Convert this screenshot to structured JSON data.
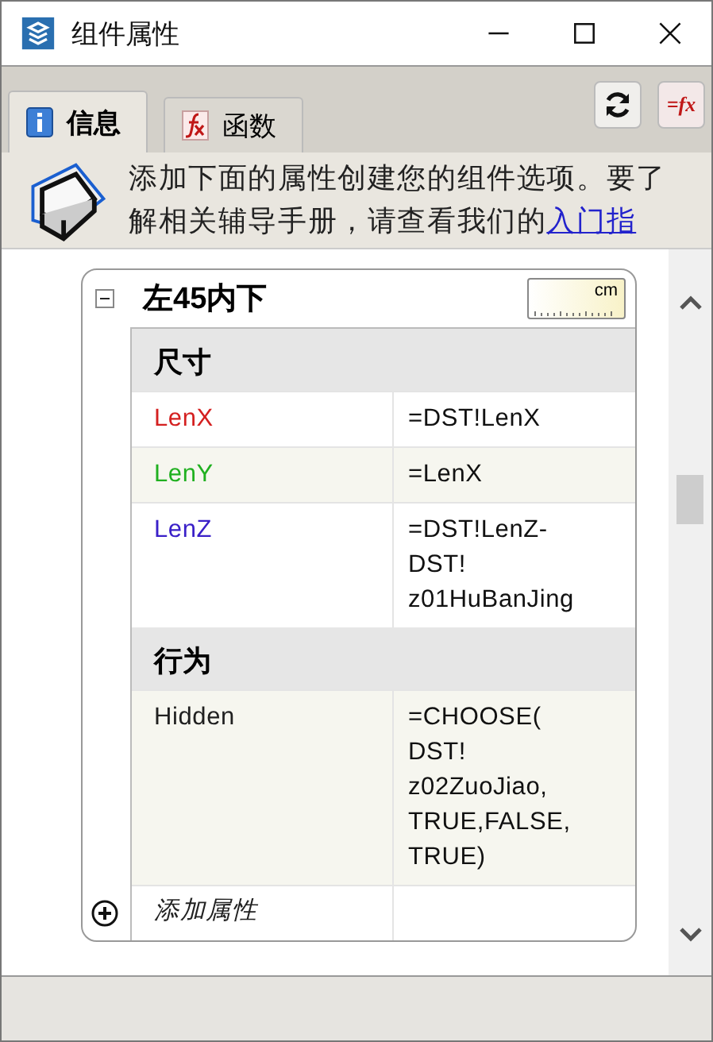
{
  "window": {
    "title": "组件属性"
  },
  "tabs": [
    {
      "label": "信息",
      "selected": true
    },
    {
      "label": "函数",
      "selected": false
    }
  ],
  "toolbar": {
    "formula_button": "=fx"
  },
  "info": {
    "text": "添加下面的属性创建您的组件选项。要了解相关辅导手册，请查看我们的",
    "link": "入门指"
  },
  "component": {
    "title": "左45内下",
    "expanded": true,
    "unit": "cm",
    "groups": [
      {
        "title": "尺寸",
        "rows": [
          {
            "name": "LenX",
            "color": "#d42020",
            "value": [
              "=DST!LenX"
            ]
          },
          {
            "name": "LenY",
            "color": "#20b020",
            "value": [
              "=LenX"
            ]
          },
          {
            "name": "LenZ",
            "color": "#3a20c8",
            "value": [
              "=DST!LenZ-",
              "DST!",
              "z01HuBanJing"
            ]
          }
        ]
      },
      {
        "title": "行为",
        "rows": [
          {
            "name": "Hidden",
            "color": "#202020",
            "value": [
              "=CHOOSE(",
              "DST!",
              "z02ZuoJiao,",
              "TRUE,FALSE,",
              "TRUE)"
            ]
          }
        ]
      }
    ],
    "add_label": "添加属性"
  }
}
